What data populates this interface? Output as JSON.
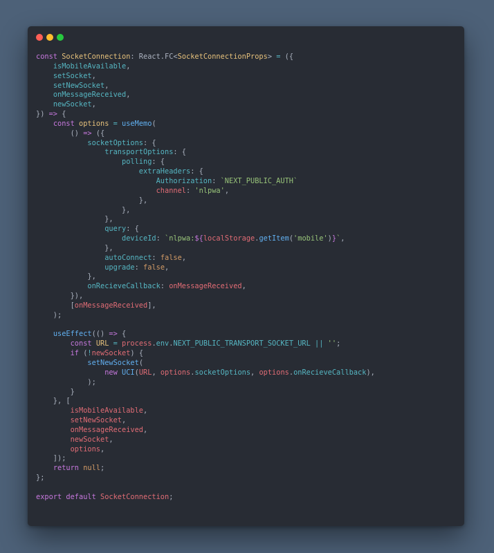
{
  "window": {
    "controls": [
      "close",
      "minimize",
      "zoom"
    ]
  },
  "code": {
    "language": "tsx",
    "lines": [
      [
        [
          "kw",
          "const "
        ],
        [
          "ty",
          "SocketConnection"
        ],
        [
          "pl",
          ": React."
        ],
        [
          "pl",
          "FC"
        ],
        [
          "pl",
          "<"
        ],
        [
          "ty",
          "SocketConnectionProps"
        ],
        [
          "pl",
          "> "
        ],
        [
          "op",
          "="
        ],
        [
          "pl",
          " ({"
        ]
      ],
      [
        [
          "pl",
          "    "
        ],
        [
          "pr",
          "isMobileAvailable"
        ],
        [
          "pl",
          ","
        ]
      ],
      [
        [
          "pl",
          "    "
        ],
        [
          "pr",
          "setSocket"
        ],
        [
          "pl",
          ","
        ]
      ],
      [
        [
          "pl",
          "    "
        ],
        [
          "pr",
          "setNewSocket"
        ],
        [
          "pl",
          ","
        ]
      ],
      [
        [
          "pl",
          "    "
        ],
        [
          "pr",
          "onMessageReceived"
        ],
        [
          "pl",
          ","
        ]
      ],
      [
        [
          "pl",
          "    "
        ],
        [
          "pr",
          "newSocket"
        ],
        [
          "pl",
          ","
        ]
      ],
      [
        [
          "pl",
          "}) "
        ],
        [
          "kw",
          "=>"
        ],
        [
          "pl",
          " {"
        ]
      ],
      [
        [
          "pl",
          "    "
        ],
        [
          "kw",
          "const "
        ],
        [
          "ty",
          "options"
        ],
        [
          "pl",
          " "
        ],
        [
          "op",
          "="
        ],
        [
          "pl",
          " "
        ],
        [
          "fn",
          "useMemo"
        ],
        [
          "pl",
          "("
        ]
      ],
      [
        [
          "pl",
          "        () "
        ],
        [
          "kw",
          "=>"
        ],
        [
          "pl",
          " ({"
        ]
      ],
      [
        [
          "pl",
          "            "
        ],
        [
          "pr",
          "socketOptions"
        ],
        [
          "pl",
          ": {"
        ]
      ],
      [
        [
          "pl",
          "                "
        ],
        [
          "pr",
          "transportOptions"
        ],
        [
          "pl",
          ": {"
        ]
      ],
      [
        [
          "pl",
          "                    "
        ],
        [
          "pr",
          "polling"
        ],
        [
          "pl",
          ": {"
        ]
      ],
      [
        [
          "pl",
          "                        "
        ],
        [
          "pr",
          "extraHeaders"
        ],
        [
          "pl",
          ": {"
        ]
      ],
      [
        [
          "pl",
          "                            "
        ],
        [
          "pr",
          "Authorization"
        ],
        [
          "pl",
          ": "
        ],
        [
          "st",
          "`NEXT_PUBLIC_AUTH`"
        ]
      ],
      [
        [
          "pl",
          "                            "
        ],
        [
          "vr",
          "channel"
        ],
        [
          "pl",
          ": "
        ],
        [
          "st",
          "'nlpwa'"
        ],
        [
          "pl",
          ","
        ]
      ],
      [
        [
          "pl",
          "                        },"
        ]
      ],
      [
        [
          "pl",
          "                    },"
        ]
      ],
      [
        [
          "pl",
          "                },"
        ]
      ],
      [
        [
          "pl",
          "                "
        ],
        [
          "pr",
          "query"
        ],
        [
          "pl",
          ": {"
        ]
      ],
      [
        [
          "pl",
          "                    "
        ],
        [
          "pr",
          "deviceId"
        ],
        [
          "pl",
          ": "
        ],
        [
          "st",
          "`nlpwa:"
        ],
        [
          "kw",
          "${"
        ],
        [
          "vr",
          "localStorage"
        ],
        [
          "pl",
          "."
        ],
        [
          "fn",
          "getItem"
        ],
        [
          "pl",
          "("
        ],
        [
          "st",
          "'mobile'"
        ],
        [
          "pl",
          ")"
        ],
        [
          "kw",
          "}"
        ],
        [
          "st",
          "`"
        ],
        [
          "pl",
          ","
        ]
      ],
      [
        [
          "pl",
          "                },"
        ]
      ],
      [
        [
          "pl",
          "                "
        ],
        [
          "pr",
          "autoConnect"
        ],
        [
          "pl",
          ": "
        ],
        [
          "nu",
          "false"
        ],
        [
          "pl",
          ","
        ]
      ],
      [
        [
          "pl",
          "                "
        ],
        [
          "pr",
          "upgrade"
        ],
        [
          "pl",
          ": "
        ],
        [
          "nu",
          "false"
        ],
        [
          "pl",
          ","
        ]
      ],
      [
        [
          "pl",
          "            },"
        ]
      ],
      [
        [
          "pl",
          "            "
        ],
        [
          "pr",
          "onRecieveCallback"
        ],
        [
          "pl",
          ": "
        ],
        [
          "vr",
          "onMessageReceived"
        ],
        [
          "pl",
          ","
        ]
      ],
      [
        [
          "pl",
          "        }),"
        ]
      ],
      [
        [
          "pl",
          "        ["
        ],
        [
          "vr",
          "onMessageReceived"
        ],
        [
          "pl",
          "],"
        ]
      ],
      [
        [
          "pl",
          "    );"
        ]
      ],
      [
        [
          "pl",
          ""
        ]
      ],
      [
        [
          "pl",
          "    "
        ],
        [
          "fn",
          "useEffect"
        ],
        [
          "pl",
          "(() "
        ],
        [
          "kw",
          "=>"
        ],
        [
          "pl",
          " {"
        ]
      ],
      [
        [
          "pl",
          "        "
        ],
        [
          "kw",
          "const "
        ],
        [
          "ty",
          "URL"
        ],
        [
          "pl",
          " "
        ],
        [
          "op",
          "="
        ],
        [
          "pl",
          " "
        ],
        [
          "vr",
          "process"
        ],
        [
          "pl",
          "."
        ],
        [
          "pr",
          "env"
        ],
        [
          "pl",
          "."
        ],
        [
          "pr",
          "NEXT_PUBLIC_TRANSPORT_SOCKET_URL"
        ],
        [
          "pl",
          " "
        ],
        [
          "op",
          "||"
        ],
        [
          "pl",
          " "
        ],
        [
          "st",
          "''"
        ],
        [
          "pl",
          ";"
        ]
      ],
      [
        [
          "pl",
          "        "
        ],
        [
          "kw",
          "if"
        ],
        [
          "pl",
          " ("
        ],
        [
          "op",
          "!"
        ],
        [
          "vr",
          "newSocket"
        ],
        [
          "pl",
          ") {"
        ]
      ],
      [
        [
          "pl",
          "            "
        ],
        [
          "fn",
          "setNewSocket"
        ],
        [
          "pl",
          "("
        ]
      ],
      [
        [
          "pl",
          "                "
        ],
        [
          "kw",
          "new "
        ],
        [
          "fn",
          "UCI"
        ],
        [
          "pl",
          "("
        ],
        [
          "vr",
          "URL"
        ],
        [
          "pl",
          ", "
        ],
        [
          "vr",
          "options"
        ],
        [
          "pl",
          "."
        ],
        [
          "pr",
          "socketOptions"
        ],
        [
          "pl",
          ", "
        ],
        [
          "vr",
          "options"
        ],
        [
          "pl",
          "."
        ],
        [
          "pr",
          "onRecieveCallback"
        ],
        [
          "pl",
          "),"
        ]
      ],
      [
        [
          "pl",
          "            );"
        ]
      ],
      [
        [
          "pl",
          "        }"
        ]
      ],
      [
        [
          "pl",
          "    }, ["
        ]
      ],
      [
        [
          "pl",
          "        "
        ],
        [
          "vr",
          "isMobileAvailable"
        ],
        [
          "pl",
          ","
        ]
      ],
      [
        [
          "pl",
          "        "
        ],
        [
          "vr",
          "setNewSocket"
        ],
        [
          "pl",
          ","
        ]
      ],
      [
        [
          "pl",
          "        "
        ],
        [
          "vr",
          "onMessageReceived"
        ],
        [
          "pl",
          ","
        ]
      ],
      [
        [
          "pl",
          "        "
        ],
        [
          "vr",
          "newSocket"
        ],
        [
          "pl",
          ","
        ]
      ],
      [
        [
          "pl",
          "        "
        ],
        [
          "vr",
          "options"
        ],
        [
          "pl",
          ","
        ]
      ],
      [
        [
          "pl",
          "    ]);"
        ]
      ],
      [
        [
          "pl",
          "    "
        ],
        [
          "kw",
          "return "
        ],
        [
          "nu",
          "null"
        ],
        [
          "pl",
          ";"
        ]
      ],
      [
        [
          "pl",
          "};"
        ]
      ],
      [
        [
          "pl",
          ""
        ]
      ],
      [
        [
          "kw",
          "export default "
        ],
        [
          "vr",
          "SocketConnection"
        ],
        [
          "pl",
          ";"
        ]
      ]
    ]
  }
}
